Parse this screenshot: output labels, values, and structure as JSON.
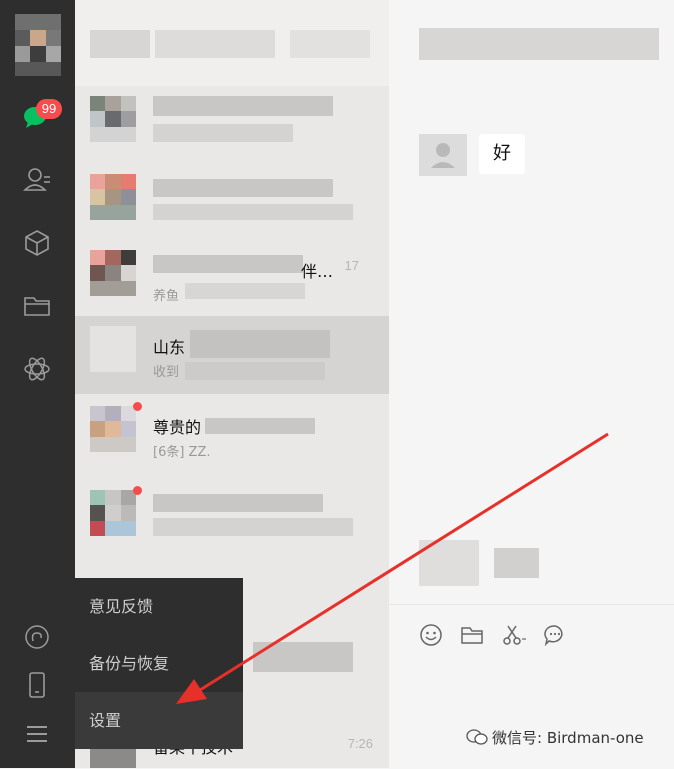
{
  "sidebar": {
    "unread_badge": "99",
    "icons": [
      "chat-icon",
      "contacts-icon",
      "box-icon",
      "folder-icon",
      "mini-program-icon",
      "link-icon",
      "phone-icon",
      "menu-icon"
    ]
  },
  "chats": [
    {
      "title": "",
      "sub": "",
      "time": ""
    },
    {
      "title": "",
      "sub": "",
      "time": ""
    },
    {
      "title": "伴…",
      "sub": "养鱼",
      "time": "17"
    },
    {
      "title": "山东",
      "sub": "收到",
      "time": ""
    },
    {
      "title": "尊贵的",
      "sub": "[6条] ZZ.",
      "time": ""
    },
    {
      "title": "",
      "sub": "",
      "time": ""
    },
    {
      "title": "",
      "sub": "",
      "time": ""
    },
    {
      "title": "留某丨技术",
      "sub": "",
      "time": "7:26"
    }
  ],
  "conversation": {
    "message_text": "好"
  },
  "settings_menu": {
    "items": [
      "意见反馈",
      "备份与恢复",
      "设置"
    ]
  },
  "watermark": {
    "text": "微信号: Birdman-one"
  },
  "colors": {
    "sidebar_bg": "#2e2e2e",
    "badge": "#f74c4b",
    "arrow": "#e8302a",
    "selected_row": "#d6d4d3"
  }
}
